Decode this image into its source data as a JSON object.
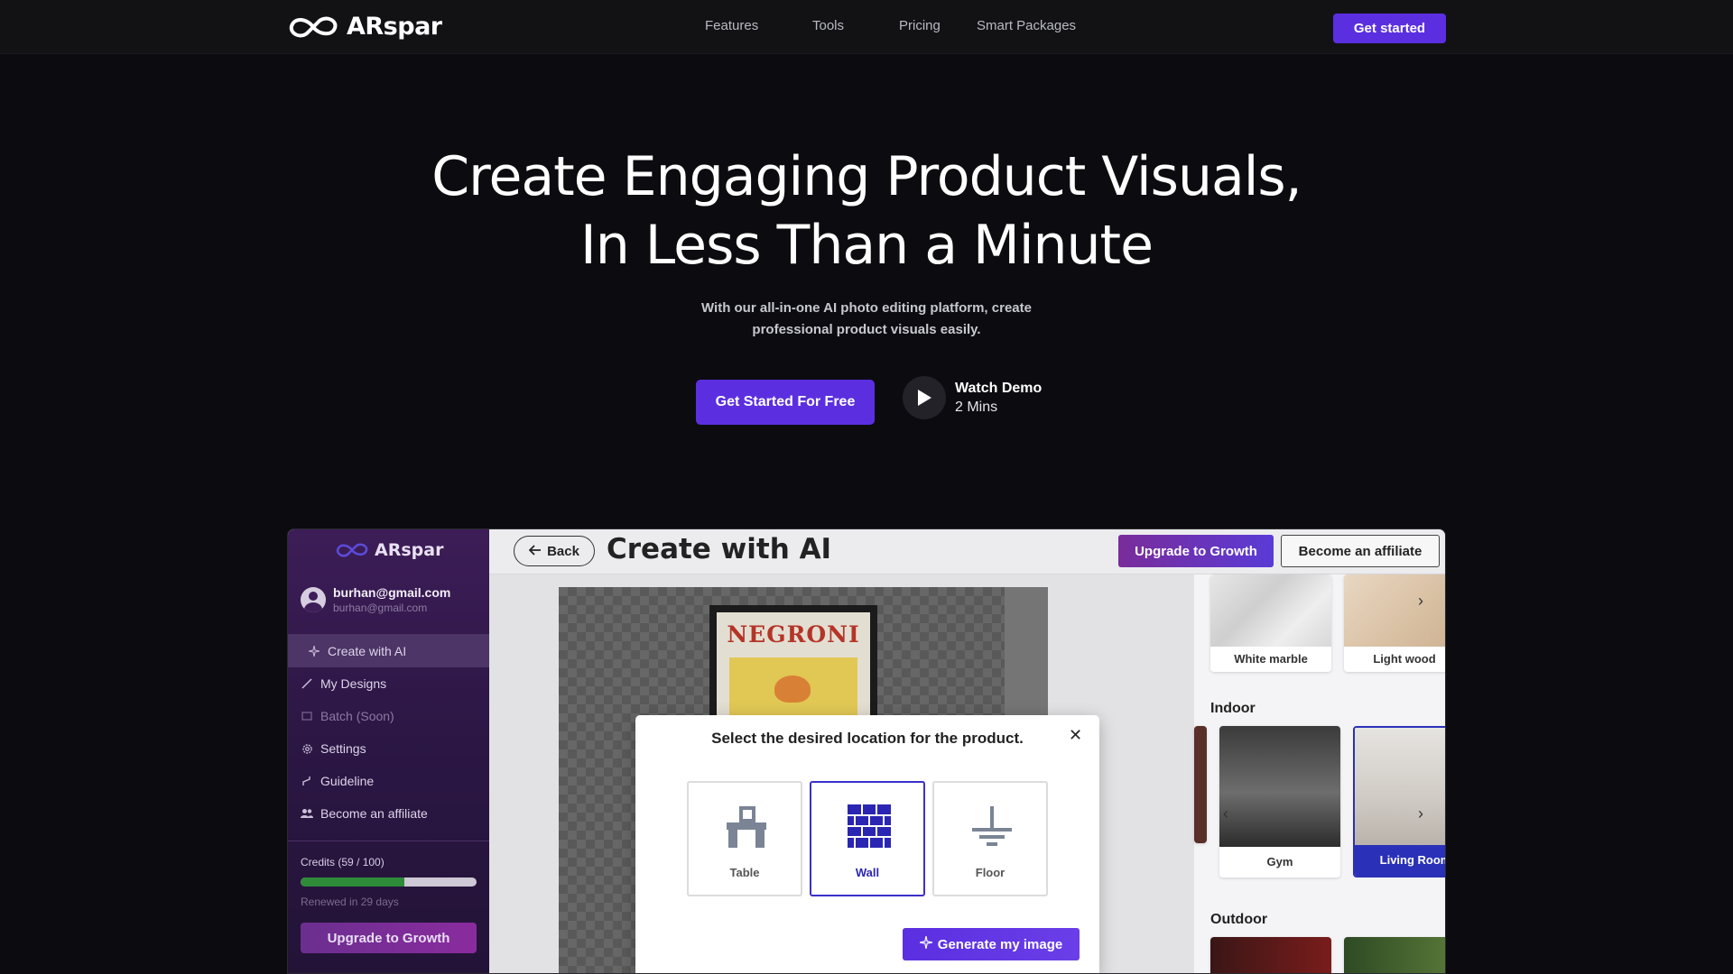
{
  "nav": {
    "brand": "ARspar",
    "links": [
      "Features",
      "Tools",
      "Pricing",
      "Smart Packages"
    ],
    "cta": "Get started"
  },
  "hero": {
    "title_line1": "Create Engaging Product Visuals,",
    "title_line2": "In Less Than a Minute",
    "subtitle_line1": "With our all-in-one AI photo editing platform, create",
    "subtitle_line2": "professional product visuals easily.",
    "primary_cta": "Get Started For Free",
    "demo_title": "Watch Demo",
    "demo_duration": "2 Mins"
  },
  "app": {
    "sidebar": {
      "brand": "ARspar",
      "user_name": "burhan@gmail.com",
      "user_email": "burhan@gmail.com",
      "items": [
        {
          "label": "Create with AI",
          "icon": "sparkle-icon"
        },
        {
          "label": "My Designs",
          "icon": "brush-icon"
        },
        {
          "label": "Batch (Soon)",
          "icon": "images-icon"
        },
        {
          "label": "Settings",
          "icon": "gear-icon"
        },
        {
          "label": "Guideline",
          "icon": "route-icon"
        },
        {
          "label": "Become an affiliate",
          "icon": "users-icon"
        }
      ],
      "credits_label": "Credits (59 / 100)",
      "credits_used": 59,
      "credits_total": 100,
      "renewal": "Renewed in 29 days",
      "upgrade": "Upgrade to Growth"
    },
    "topbar": {
      "back": "Back",
      "title": "Create with AI",
      "upgrade": "Upgrade to Growth",
      "affiliate": "Become an affiliate"
    },
    "poster_text": "NEGRONI",
    "right_panel": {
      "surfaces": [
        "White marble",
        "Light wood"
      ],
      "indoor_title": "Indoor",
      "indoor": [
        "Gym",
        "Living Room"
      ],
      "indoor_selected": "Living Room",
      "outdoor_title": "Outdoor"
    },
    "modal": {
      "title": "Select the desired location for the product.",
      "options": [
        "Table",
        "Wall",
        "Floor"
      ],
      "selected": "Wall",
      "generate": "Generate my image"
    }
  },
  "colors": {
    "accent": "#5b2fe0",
    "background": "#0c0c10",
    "selected_border": "#3b30c9"
  }
}
